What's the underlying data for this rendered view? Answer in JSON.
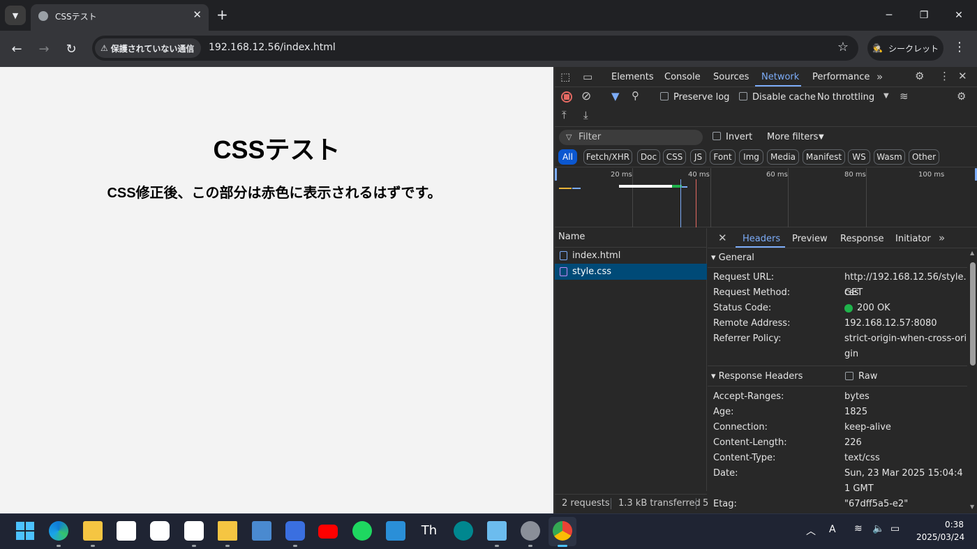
{
  "browser": {
    "tab_title": "CSSテスト",
    "new_tab": "+",
    "security_label": "保護されていない通信",
    "url": "192.168.12.56/index.html",
    "incognito_label": "シークレット"
  },
  "page": {
    "heading": "CSSテスト",
    "paragraph": "CSS修正後、この部分は赤色に表示されるはずです。"
  },
  "devtools": {
    "tabs": [
      "Elements",
      "Console",
      "Sources",
      "Network",
      "Performance"
    ],
    "active_tab": "Network",
    "toolbar": {
      "preserve_log": "Preserve log",
      "disable_cache": "Disable cache",
      "throttling": "No throttling"
    },
    "filter": {
      "placeholder": "Filter",
      "invert": "Invert",
      "more_filters": "More filters"
    },
    "type_filters": [
      "All",
      "Fetch/XHR",
      "Doc",
      "CSS",
      "JS",
      "Font",
      "Img",
      "Media",
      "Manifest",
      "WS",
      "Wasm",
      "Other"
    ],
    "active_type": "All",
    "timeline_ticks": [
      "20 ms",
      "40 ms",
      "60 ms",
      "80 ms",
      "100 ms"
    ],
    "requests_header": "Name",
    "requests": [
      {
        "name": "index.html",
        "selected": false
      },
      {
        "name": "style.css",
        "selected": true
      }
    ],
    "status": {
      "requests": "2 requests",
      "transferred": "1.3 kB transferred",
      "extra": "5"
    },
    "detail_tabs": [
      "Headers",
      "Preview",
      "Response",
      "Initiator"
    ],
    "active_detail_tab": "Headers",
    "general_title": "General",
    "general": [
      {
        "key": "Request URL:",
        "value": "http://192.168.12.56/style.css"
      },
      {
        "key": "Request Method:",
        "value": "GET"
      },
      {
        "key": "Status Code:",
        "value": "200 OK"
      },
      {
        "key": "Remote Address:",
        "value": "192.168.12.57:8080"
      },
      {
        "key": "Referrer Policy:",
        "value": "strict-origin-when-cross-origin"
      }
    ],
    "response_headers_title": "Response Headers",
    "raw_label": "Raw",
    "response_headers": [
      {
        "key": "Accept-Ranges:",
        "value": "bytes"
      },
      {
        "key": "Age:",
        "value": "1825"
      },
      {
        "key": "Connection:",
        "value": "keep-alive"
      },
      {
        "key": "Content-Length:",
        "value": "226"
      },
      {
        "key": "Content-Type:",
        "value": "text/css"
      },
      {
        "key": "Date:",
        "value": "Sun, 23 Mar 2025 15:04:41 GMT"
      },
      {
        "key": "Etag:",
        "value": "\"67dff5a5-e2\""
      }
    ],
    "colors": {
      "accent": "#7cacf8",
      "selected_row": "#004a77",
      "status_ok": "#1fb34b",
      "record": "#e46962"
    }
  },
  "taskbar": {
    "time": "0:38",
    "date": "2025/03/24"
  }
}
